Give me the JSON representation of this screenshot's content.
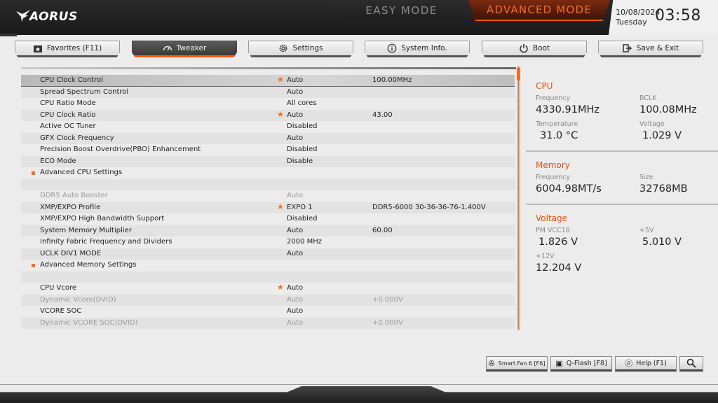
{
  "header": {
    "logo_text": "AORUS",
    "easy_mode_label": "EASY MODE",
    "advanced_mode_label": "ADVANCED MODE",
    "date": "10/08/2024",
    "day": "Tuesday",
    "time": "03:58"
  },
  "nav": {
    "favorites": "Favorites (F11)",
    "tweaker": "Tweaker",
    "settings": "Settings",
    "system_info": "System Info.",
    "boot": "Boot",
    "save_exit": "Save & Exit"
  },
  "settings": [
    {
      "label": "CPU Clock Control",
      "value": "Auto",
      "info": "100.00MHz",
      "star": true
    },
    {
      "label": "Spread Spectrum Control",
      "value": "Auto",
      "info": ""
    },
    {
      "label": "CPU Ratio Mode",
      "value": "All cores",
      "info": ""
    },
    {
      "label": "CPU Clock Ratio",
      "value": "Auto",
      "info": "43.00",
      "star": true
    },
    {
      "label": "Active OC Tuner",
      "value": "Disabled",
      "info": ""
    },
    {
      "label": "GFX Clock Frequency",
      "value": "Auto",
      "info": ""
    },
    {
      "label": "Precision Boost Overdrive(PBO) Enhancement",
      "value": "Disabled",
      "info": ""
    },
    {
      "label": "ECO Mode",
      "value": "Disable",
      "info": ""
    },
    {
      "label": "Advanced CPU Settings",
      "value": "",
      "info": "",
      "submenu": true
    },
    {
      "label": "",
      "value": "",
      "info": ""
    },
    {
      "label": "DDR5 Auto Booster",
      "value": "Auto",
      "info": "",
      "dim": true
    },
    {
      "label": "XMP/EXPO Profile",
      "value": "EXPO 1",
      "info": "DDR5-6000 30-36-36-76-1.400V",
      "star": true
    },
    {
      "label": "XMP/EXPO High Bandwidth Support",
      "value": "Disabled",
      "info": ""
    },
    {
      "label": "System Memory Multiplier",
      "value": "Auto",
      "info": "60.00"
    },
    {
      "label": "Infinity Fabric Frequency and Dividers",
      "value": "2000 MHz",
      "info": ""
    },
    {
      "label": "UCLK DIV1 MODE",
      "value": "Auto",
      "info": ""
    },
    {
      "label": "Advanced Memory Settings",
      "value": "",
      "info": "",
      "submenu": true
    },
    {
      "label": "",
      "value": "",
      "info": ""
    },
    {
      "label": "CPU Vcore",
      "value": "Auto",
      "info": "",
      "star": true
    },
    {
      "label": "Dynamic Vcore(DVID)",
      "value": "Auto",
      "info": "+0.000V",
      "dim": true
    },
    {
      "label": "VCORE SOC",
      "value": "Auto",
      "info": ""
    },
    {
      "label": "Dynamic VCORE SOC(DVID)",
      "value": "Auto",
      "info": "+0.000V",
      "dim": true
    }
  ],
  "info": {
    "cpu": {
      "title": "CPU",
      "frequency_label": "Frequency",
      "frequency": "4330.91MHz",
      "bclk_label": "BCLK",
      "bclk": "100.08MHz",
      "temperature_label": "Temperature",
      "temperature": "31.0 °C",
      "voltage_label": "Voltage",
      "voltage": "1.029 V"
    },
    "memory": {
      "title": "Memory",
      "frequency_label": "Frequency",
      "frequency": "6004.98MT/s",
      "size_label": "Size",
      "size": "32768MB"
    },
    "voltage": {
      "title": "Voltage",
      "pm_vcc18_label": "PM VCC18",
      "pm_vcc18": "1.826 V",
      "v5_label": "+5V",
      "v5": "5.010 V",
      "v12_label": "+12V",
      "v12": "12.204 V"
    }
  },
  "bottom": {
    "smart_fan": "Smart Fan 6 [F6]",
    "qflash": "Q-Flash [F8]",
    "help": "Help (F1)"
  },
  "colors": {
    "accent": "#ff6a1a",
    "section_title": "#e8500e"
  }
}
